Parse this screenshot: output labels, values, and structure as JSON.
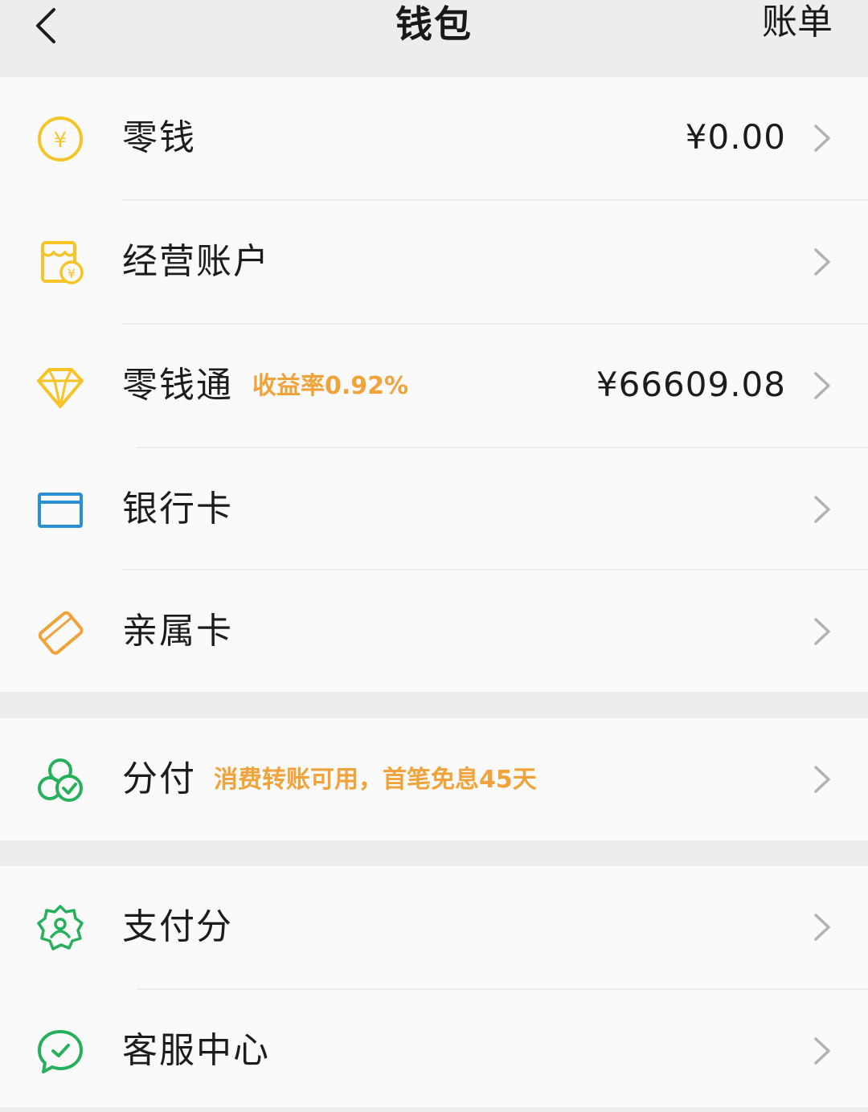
{
  "header": {
    "title": "钱包",
    "right_action": "账单"
  },
  "groups": [
    {
      "items": [
        {
          "label": "零钱",
          "value": "¥0.00",
          "icon": "coin-yuan-icon"
        },
        {
          "label": "经营账户",
          "icon": "store-account-icon"
        },
        {
          "label": "零钱通",
          "tag": "收益率0.92%",
          "value": "¥66609.08",
          "icon": "diamond-icon"
        },
        {
          "label": "银行卡",
          "icon": "bank-card-icon"
        },
        {
          "label": "亲属卡",
          "icon": "family-card-icon"
        }
      ]
    },
    {
      "items": [
        {
          "label": "分付",
          "tag": "消费转账可用，首笔免息45天",
          "icon": "fenfu-icon"
        }
      ]
    },
    {
      "items": [
        {
          "label": "支付分",
          "icon": "pay-score-icon"
        },
        {
          "label": "客服中心",
          "icon": "customer-service-icon"
        }
      ]
    }
  ],
  "colors": {
    "background": "#ededed",
    "panel": "#fafafa",
    "coin_yellow": "#f6c427",
    "orange": "#f0a33b",
    "blue": "#2b8fd6",
    "green": "#27b05c",
    "chevron": "#b2b2b2"
  }
}
